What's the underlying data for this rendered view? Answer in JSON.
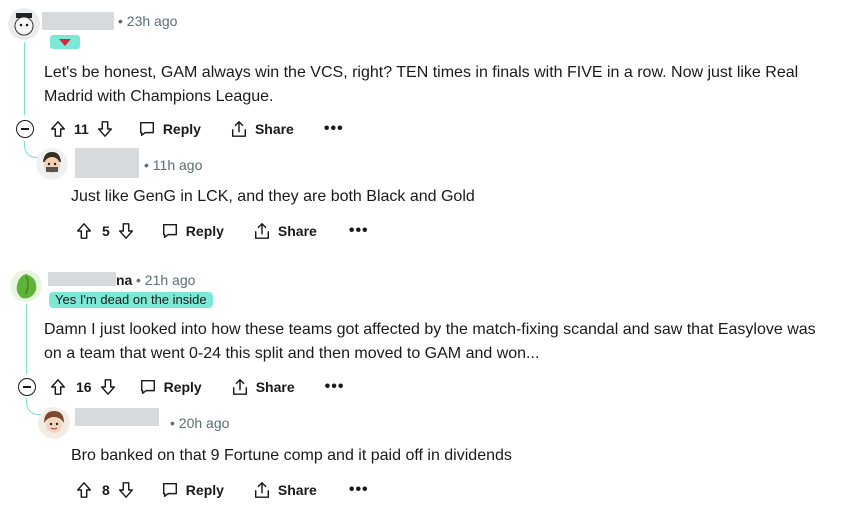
{
  "comments": [
    {
      "time": "• 23h ago",
      "body_lines": [
        "Let's be honest, GAM always win the VCS, right? TEN times in finals with FIVE in a row. Now just like Real",
        "Madrid with Champions League."
      ],
      "votes": "11",
      "reply_label": "Reply",
      "share_label": "Share",
      "more_label": "•••"
    },
    {
      "time": "• 11h ago",
      "body_lines": [
        "Just like GenG in LCK, and they are both Black and Gold"
      ],
      "votes": "5",
      "reply_label": "Reply",
      "share_label": "Share",
      "more_label": "•••"
    },
    {
      "name_suffix": "na",
      "time": "• 21h ago",
      "flair": "Yes I'm dead on the inside",
      "body_lines": [
        "Damn I just looked into how these teams got affected by the match-fixing scandal and saw that Easylove was",
        "on a team that went 0-24 this split and then moved to GAM and won..."
      ],
      "votes": "16",
      "reply_label": "Reply",
      "share_label": "Share",
      "more_label": "•••"
    },
    {
      "time": "• 20h ago",
      "body_lines": [
        "Bro banked on that 9 Fortune comp and it paid off in dividends"
      ],
      "votes": "8",
      "reply_label": "Reply",
      "share_label": "Share",
      "more_label": "•••"
    }
  ],
  "colors": {
    "thread_line": "#7ee0c8",
    "flair_bg": "#7ee8d6",
    "redacted": "#d7dadc"
  }
}
